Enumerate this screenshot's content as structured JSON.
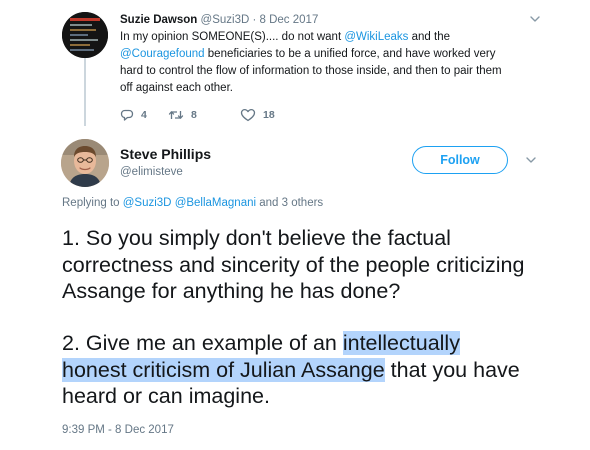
{
  "parent_tweet": {
    "author_name": "Suzie Dawson",
    "author_handle": "@Suzi3D",
    "separator": " · ",
    "date": "8 Dec 2017",
    "text_part1": "In my opinion SOMEONE(S).... do not want ",
    "mention1": "@WikiLeaks",
    "text_part2": " and the ",
    "mention2": "@Couragefound",
    "text_part3": " beneficiaries to be a unified force, and have worked very hard to control the flow of information to those inside, and then to pair them off against each other.",
    "reply_count": "4",
    "retweet_count": "8",
    "like_count": "18"
  },
  "main_tweet": {
    "author_name": "Steve Phillips",
    "author_handle": "@elimisteve",
    "follow_label": "Follow",
    "replying_prefix": "Replying to ",
    "replying_mention1": "@Suzi3D",
    "replying_mention2": "@BellaMagnani",
    "replying_suffix": " and 3 others",
    "paragraph1": "1. So you simply don't believe the factual correctness and sincerity of the people criticizing Assange for anything he has done?",
    "paragraph2_before": "2. Give me an example of an ",
    "paragraph2_highlight1": "intellectually",
    "paragraph2_highlight2": "honest criticism of Julian Assange",
    "paragraph2_after": " that you have heard or can imagine.",
    "timestamp": "9:39 PM - 8 Dec 2017"
  },
  "colors": {
    "link": "#1b95e0",
    "follow_blue": "#1da1f2",
    "secondary_text": "#657786",
    "selection_highlight": "#b3d4fc"
  },
  "icons": {
    "reply": "reply-icon",
    "retweet": "retweet-icon",
    "like": "heart-icon",
    "caret": "chevron-down-icon"
  }
}
